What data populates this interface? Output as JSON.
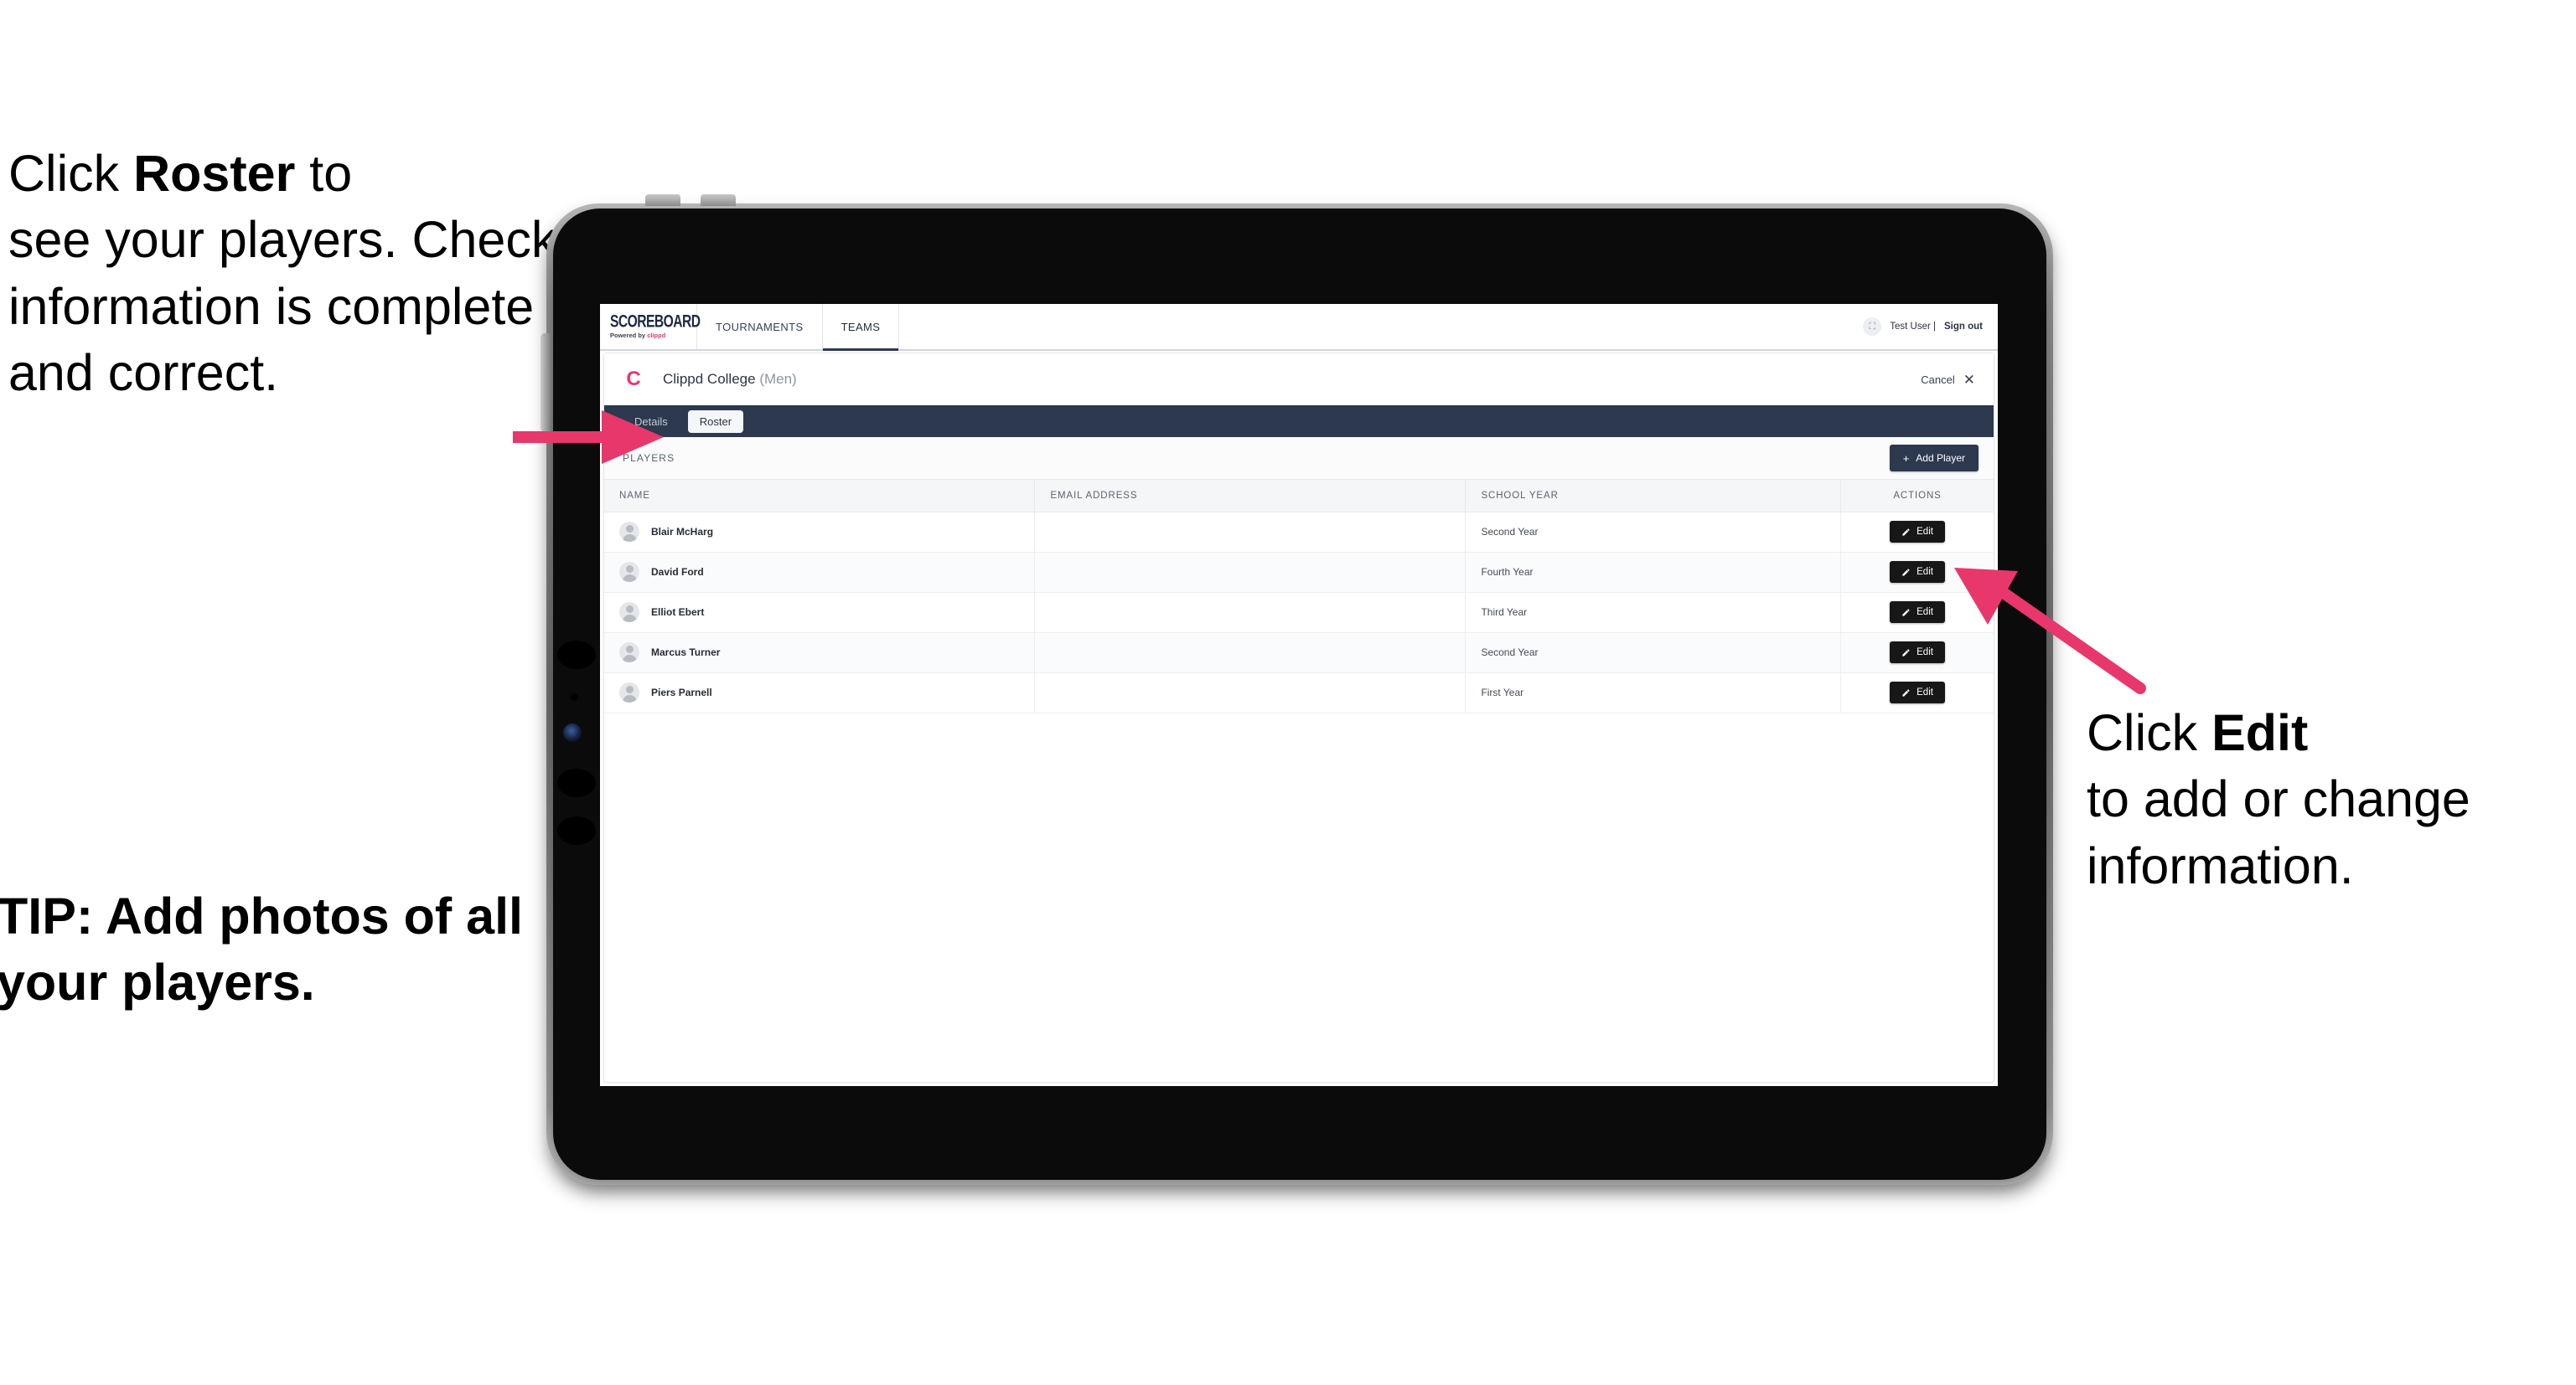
{
  "annotations": {
    "left_line1_pre": "Click ",
    "left_bold": "Roster",
    "left_line1_post": " to",
    "left_rest": "see your players. Check information is complete and correct.",
    "tip": "TIP: Add photos of all your players.",
    "right_pre": "Click ",
    "right_bold": "Edit",
    "right_rest": "to add or change information."
  },
  "colors": {
    "accent_pink": "#e8376b",
    "arrow_pink": "#e8376b",
    "navy": "#2c394f",
    "edit_black": "#171717"
  },
  "topnav": {
    "logo_word": "SCOREBOARD",
    "logo_powered_pre": "Powered by ",
    "logo_brand": "clippd",
    "tabs": [
      {
        "label": "TOURNAMENTS",
        "active": false
      },
      {
        "label": "TEAMS",
        "active": true
      }
    ],
    "user_avatar_glyph": "⛶",
    "user_name": "Test User |",
    "sign_out": "Sign out"
  },
  "card_header": {
    "team_logo_letter": "C",
    "team_name": "Clippd College",
    "team_gender": "(Men)",
    "cancel_label": "Cancel",
    "cancel_icon": "✕"
  },
  "tabstrip": {
    "tabs": [
      {
        "label": "Details",
        "active": false
      },
      {
        "label": "Roster",
        "active": true
      }
    ]
  },
  "players_bar": {
    "section_label": "PLAYERS",
    "add_player_plus": "+",
    "add_player_label": "Add Player"
  },
  "table": {
    "columns": [
      "NAME",
      "EMAIL ADDRESS",
      "SCHOOL YEAR",
      "ACTIONS"
    ],
    "edit_label": "Edit",
    "rows": [
      {
        "name": "Blair McHarg",
        "email": "",
        "school_year": "Second Year"
      },
      {
        "name": "David Ford",
        "email": "",
        "school_year": "Fourth Year"
      },
      {
        "name": "Elliot Ebert",
        "email": "",
        "school_year": "Third Year"
      },
      {
        "name": "Marcus Turner",
        "email": "",
        "school_year": "Second Year"
      },
      {
        "name": "Piers Parnell",
        "email": "",
        "school_year": "First Year"
      }
    ]
  }
}
